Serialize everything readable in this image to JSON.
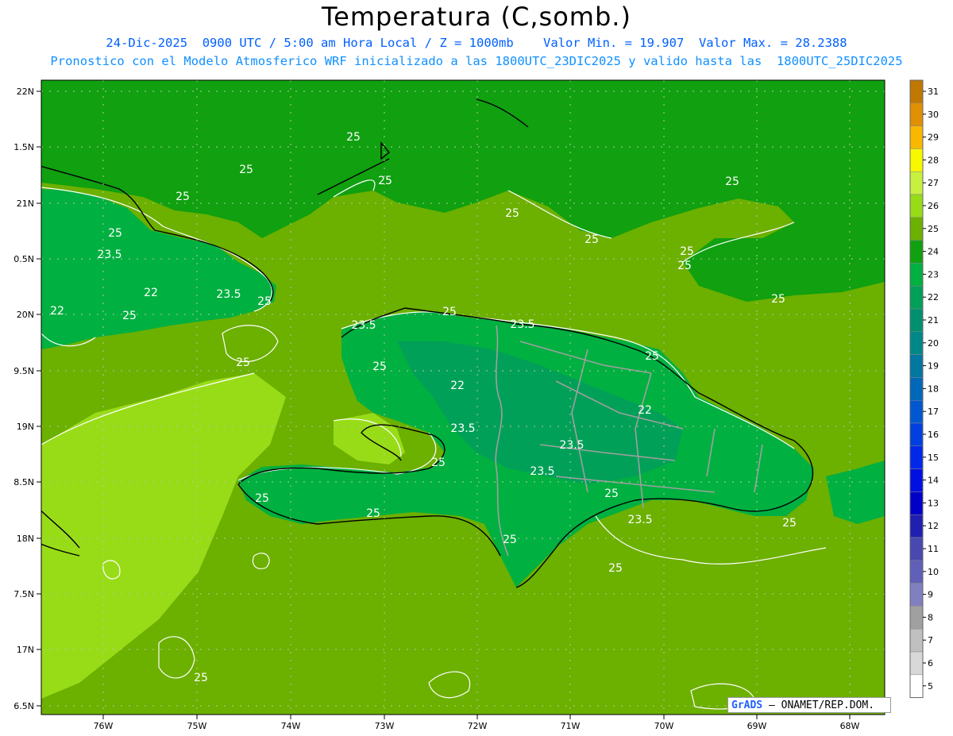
{
  "header": {
    "title": "Temperatura (C,somb.)",
    "line1": "24-Dic-2025  0900 UTC / 5:00 am Hora Local / Z = 1000mb    Valor Min. = 19.907  Valor Max. = 28.2388",
    "line2": "Pronostico con el Modelo Atmosferico WRF inicializado a las 1800UTC_23DIC2025 y valido hasta las  1800UTC_25DIC2025"
  },
  "map": {
    "lat_ticks": [
      "22N",
      "1.5N",
      "21N",
      "0.5N",
      "20N",
      "9.5N",
      "19N",
      "8.5N",
      "18N",
      "7.5N",
      "17N",
      "6.5N"
    ],
    "lon_ticks": [
      "76W",
      "75W",
      "74W",
      "73W",
      "72W",
      "71W",
      "70W",
      "69W",
      "68W"
    ],
    "contour_labels": [
      "25",
      "25",
      "25",
      "25",
      "25",
      "25",
      "25",
      "25",
      "25",
      "25",
      "25",
      "25",
      "25",
      "25",
      "25",
      "25",
      "25",
      "25",
      "25",
      "25",
      "23.5",
      "23.5",
      "23.5",
      "23.5",
      "23.5",
      "23.5",
      "23.5",
      "23.5",
      "23.5",
      "22",
      "22",
      "22",
      "22"
    ],
    "colorbar": {
      "labels": [
        "31",
        "30",
        "29",
        "28",
        "27",
        "26",
        "25",
        "24",
        "23",
        "22",
        "21",
        "20",
        "19",
        "18",
        "17",
        "16",
        "15",
        "14",
        "13",
        "12",
        "11",
        "10",
        "9",
        "8",
        "7",
        "6",
        "5"
      ],
      "colors": [
        "#c07800",
        "#e09000",
        "#f8b800",
        "#f8f800",
        "#c8f040",
        "#98dc18",
        "#6cb000",
        "#10a010",
        "#00b040",
        "#00a058",
        "#009070",
        "#008888",
        "#0078a0",
        "#0068b8",
        "#0058d0",
        "#0040e0",
        "#0028e8",
        "#0010e0",
        "#0000c8",
        "#2020b0",
        "#4848b0",
        "#6060b8",
        "#8080c0",
        "#a0a0a0",
        "#c0c0c0",
        "#d8d8d8",
        "#ffffff"
      ]
    },
    "colors": {
      "sea_main": "#6cb000",
      "sea_light": "#98dc18",
      "north_band": "#10a010",
      "land_warm": "#00b040",
      "land_cool": "#00a058",
      "coast": "#000000",
      "contour": "#ffffff",
      "border": "#a0a0a0"
    }
  },
  "credit": {
    "logo": "GrADS",
    "text": "– ONAMET/REP.DOM."
  }
}
